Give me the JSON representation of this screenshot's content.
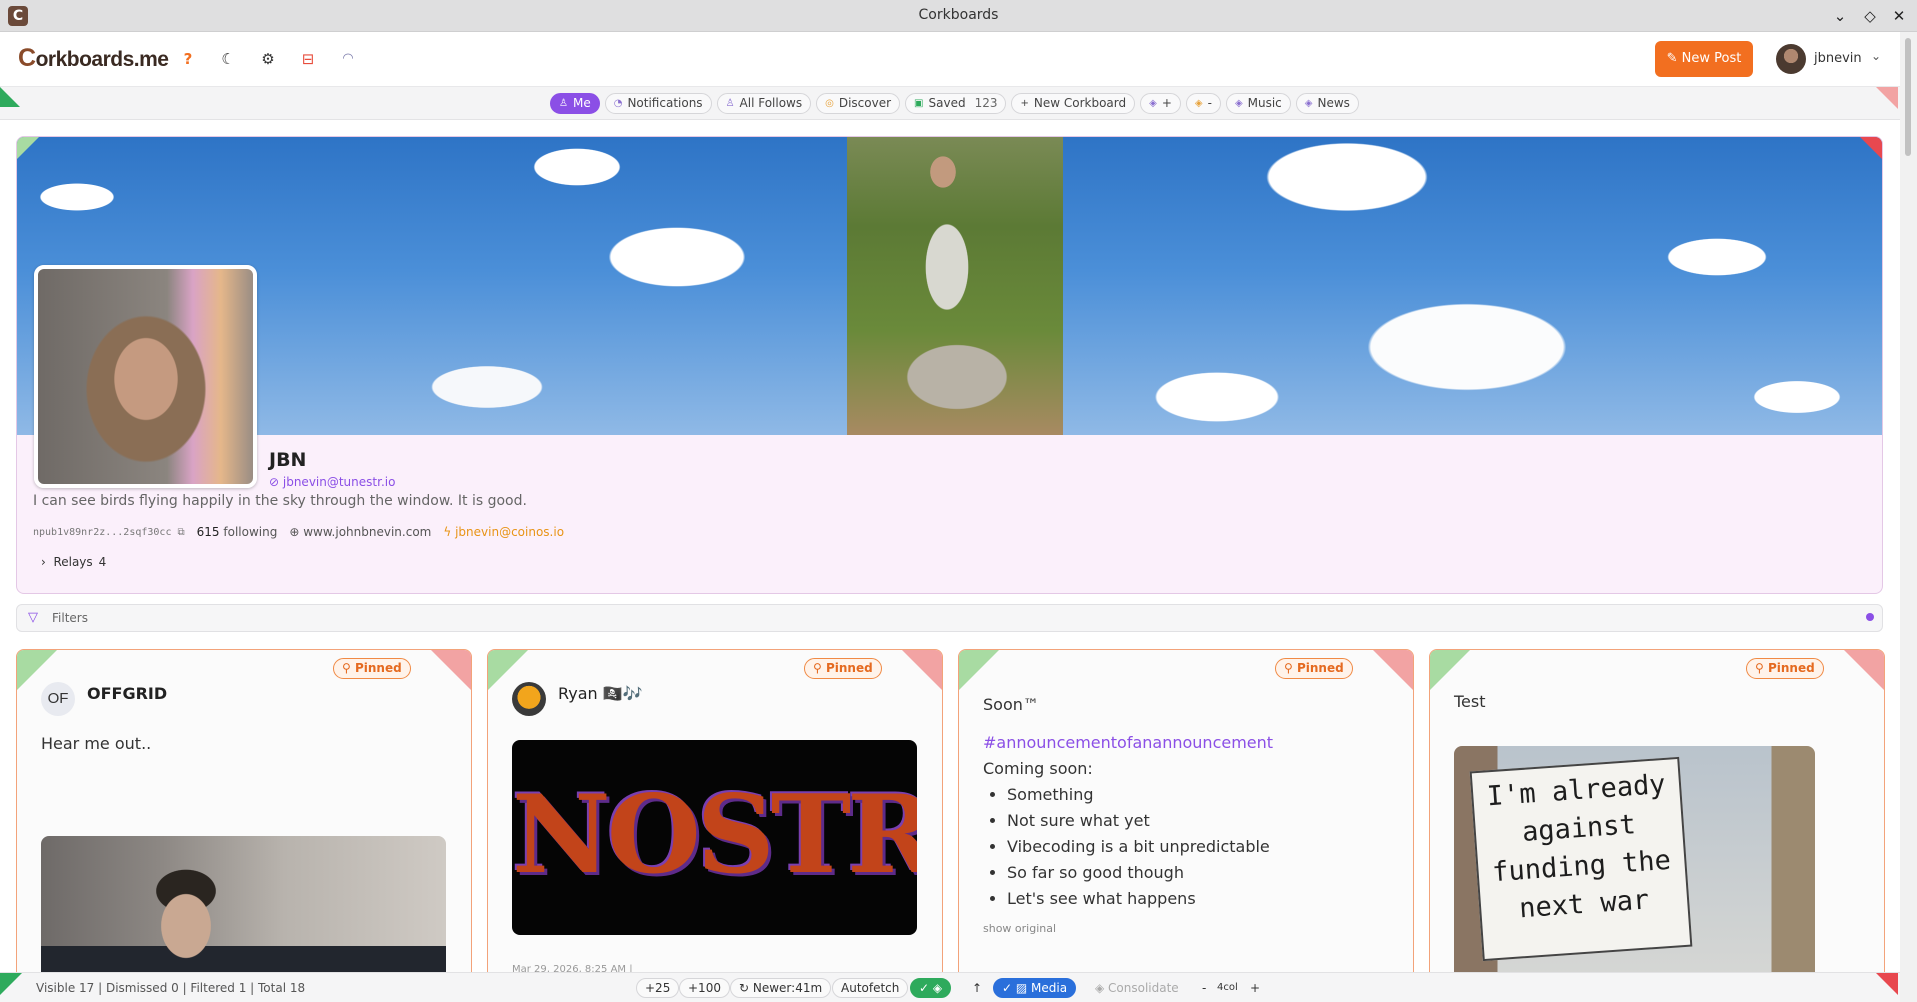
{
  "window": {
    "title": "Corkboards",
    "controls": [
      "chevron-down",
      "diamond",
      "close"
    ]
  },
  "header": {
    "logo": "orkboards.me",
    "logo_initial": "C",
    "help_icon": "?",
    "new_post_label": "New Post",
    "user_name": "jbnevin"
  },
  "tabs": [
    {
      "label": "Me",
      "icon": "user-icon",
      "active": true
    },
    {
      "label": "Notifications",
      "icon": "bell-icon"
    },
    {
      "label": "All Follows",
      "icon": "users-icon"
    },
    {
      "label": "Discover",
      "icon": "compass-icon"
    },
    {
      "label": "Saved",
      "icon": "bookmark-icon",
      "count": "123"
    },
    {
      "label": "New Corkboard",
      "icon": "plus-icon"
    },
    {
      "label": "+",
      "icon": "layers-icon"
    },
    {
      "label": "-",
      "icon": "layers-icon"
    },
    {
      "label": "Music",
      "icon": "layers-icon"
    },
    {
      "label": "News",
      "icon": "layers-icon"
    }
  ],
  "profile": {
    "name": "JBN",
    "nip05": "jbnevin@tunestr.io",
    "bio": "I can see birds flying happily in the sky through the window.  It is good.",
    "npub": "npub1v89nr2z...2sqf30cc",
    "following_count": "615",
    "following_label": "following",
    "website": "www.johnbnevin.com",
    "lightning": "jbnevin@coinos.io",
    "relays_label": "Relays",
    "relays_count": "4"
  },
  "filters": {
    "label": "Filters"
  },
  "cards": [
    {
      "author": "OFFGRID",
      "avatar_text": "OF",
      "pinned": "Pinned",
      "text": "Hear me out.."
    },
    {
      "author": "Ryan 🏴‍☠️🎶",
      "pinned": "Pinned",
      "image_text": "NOSTR",
      "meta": "Mar 29, 2026, 8:25 AM |"
    },
    {
      "pinned": "Pinned",
      "title": "Soon™",
      "hashtag": "#announcementofanannouncement",
      "intro": "Coming soon:",
      "items": [
        "Something",
        "Not sure what yet",
        "Vibecoding is a bit unpredictable",
        "So far so good though",
        "Let's see what happens"
      ],
      "show_original": "show original"
    },
    {
      "pinned": "Pinned",
      "title": "Test",
      "sign_text": "I'm already against funding the next war"
    }
  ],
  "status": {
    "stats": "Visible 17 | Dismissed 0 | Filtered 1 | Total 18",
    "plus25": "+25",
    "plus100": "+100",
    "newer": "Newer:41m",
    "autofetch": "Autofetch",
    "media": "Media",
    "consolidate": "Consolidate",
    "minus": "-",
    "columns": "4col",
    "plus": "+"
  },
  "colors": {
    "accent": "#8b4fe6",
    "primary_button": "#f26f20",
    "pinned": "#e56a20",
    "success": "#2eaa5c",
    "media_toggle": "#2a6fdb"
  }
}
